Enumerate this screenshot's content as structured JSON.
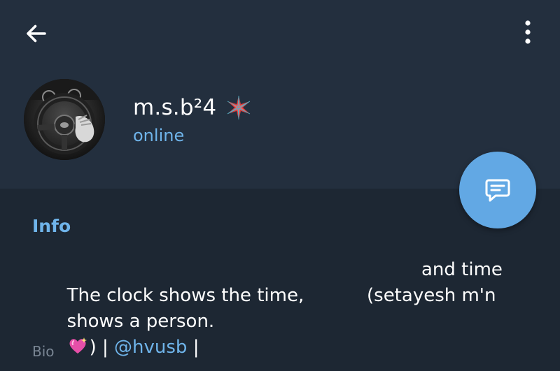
{
  "header": {
    "back_icon": "arrow-left-icon",
    "menu_icon": "more-vertical-icon",
    "name": "m.s.b²4",
    "name_emoji": "red-star-emoji",
    "status": "online",
    "avatar": "steering-wheel-photo"
  },
  "fab": {
    "icon": "message-icon"
  },
  "info": {
    "section_title": "Info",
    "bio": {
      "line1_left": "The clock shows the time,",
      "line1_right": "and time",
      "line2_left": "shows a person.",
      "line2_right": "(setayesh m'n",
      "line3_heart": "sparkling-heart-emoji",
      "line3_before": ") | ",
      "line3_mention": "@hvusb",
      "line3_after": " |"
    },
    "bio_label": "Bio"
  },
  "colors": {
    "header_bg": "#232f3e",
    "body_bg": "#1d2733",
    "accent": "#6fb4ea",
    "fab": "#62a8e4",
    "secondary_text": "#7a8694"
  }
}
